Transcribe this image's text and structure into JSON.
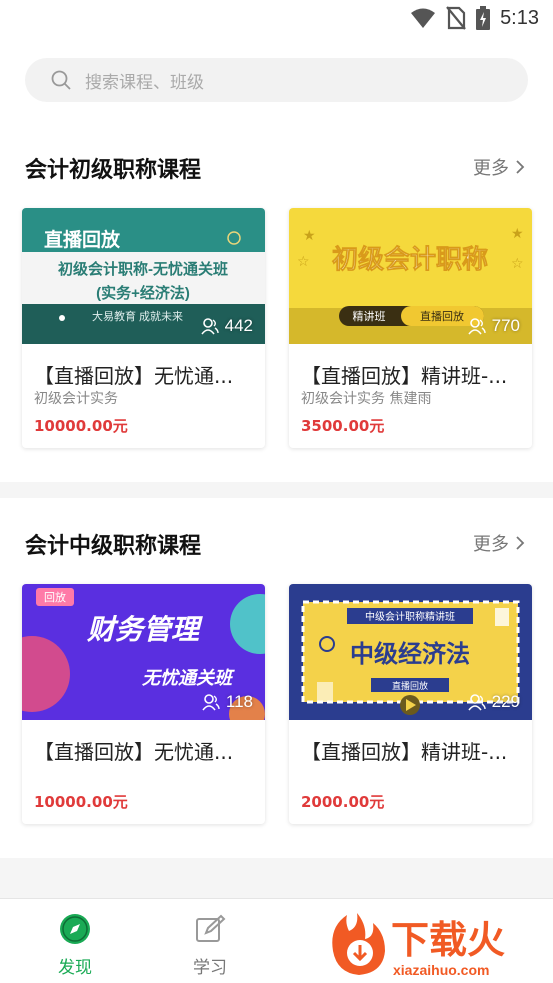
{
  "statusbar": {
    "time": "5:13"
  },
  "search": {
    "placeholder": "搜索课程、班级"
  },
  "sections": [
    {
      "title": "会计初级职称课程",
      "more": "更多",
      "courses": [
        {
          "title": "【直播回放】无忧通...",
          "subtitle": "初级会计实务",
          "price": "10000.00元",
          "views": "442",
          "thumb": {
            "tag": "直播回放",
            "line1": "初级会计职称-无忧通关班",
            "line2": "(实务+经济法)",
            "footer": "大易教育  成就未来"
          }
        },
        {
          "title": "【直播回放】精讲班-...",
          "subtitle": "初级会计实务 焦建雨",
          "price": "3500.00元",
          "views": "770",
          "thumb": {
            "heading": "初级会计职称",
            "pill_left": "精讲班",
            "pill_right": "直播回放"
          }
        }
      ]
    },
    {
      "title": "会计中级职称课程",
      "more": "更多",
      "courses": [
        {
          "title": "【直播回放】无忧通...",
          "subtitle": "",
          "price": "10000.00元",
          "views": "118",
          "thumb": {
            "tag": "回放",
            "heading": "财务管理",
            "sub": "无忧通关班"
          }
        },
        {
          "title": "【直播回放】精讲班-...",
          "subtitle": "",
          "price": "2000.00元",
          "views": "229",
          "thumb": {
            "banner": "中级会计职称精讲班",
            "heading": "中级经济法",
            "pill": "直播回放"
          }
        }
      ]
    }
  ],
  "nav": [
    {
      "label": "发现",
      "icon": "compass-icon",
      "active": true
    },
    {
      "label": "学习",
      "icon": "edit-icon",
      "active": false
    }
  ],
  "watermark": {
    "text": "下载火",
    "url": "xiazaihuo.com"
  },
  "colors": {
    "accent": "#1aaa55",
    "price": "#e03a3a",
    "teal": "#2a8f86",
    "yellow": "#f5d93c",
    "purple": "#5a2fe0",
    "navy": "#2b3d8f"
  }
}
